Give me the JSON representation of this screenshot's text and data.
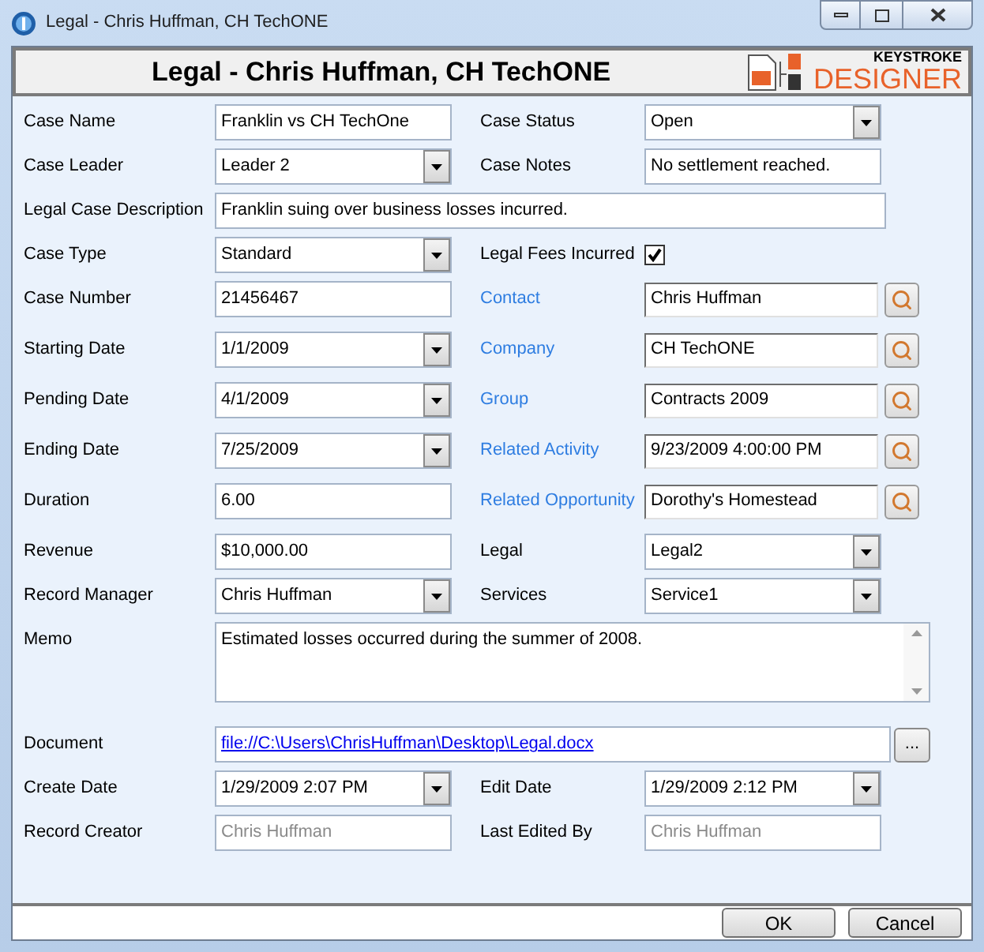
{
  "window": {
    "title": "Legal - Chris Huffman, CH TechONE"
  },
  "header": {
    "title": "Legal - Chris Huffman, CH TechONE",
    "logo_top": "KEYSTROKE",
    "logo_bottom": "DESIGNER"
  },
  "rows": [
    {
      "cells": [
        {
          "label": "Case Name",
          "link": false,
          "kind": "text",
          "value": "Franklin vs CH TechOne"
        },
        {
          "label": "Case Status",
          "link": false,
          "kind": "dropdown",
          "value": "Open"
        }
      ]
    },
    {
      "cells": [
        {
          "label": "Case Leader",
          "link": false,
          "kind": "dropdown",
          "value": "Leader 2"
        },
        {
          "label": "Case Notes",
          "link": false,
          "kind": "text",
          "value": "No settlement reached."
        }
      ]
    },
    {
      "cells": [
        {
          "label": "Legal Case Description",
          "link": false,
          "kind": "wide",
          "value": "Franklin suing over business losses incurred."
        }
      ]
    },
    {
      "cells": [
        {
          "label": "Case Type",
          "link": false,
          "kind": "dropdown",
          "value": "Standard"
        },
        {
          "label": "Legal Fees Incurred",
          "link": false,
          "kind": "checkbox",
          "checked": true
        }
      ]
    },
    {
      "cells": [
        {
          "label": "Case Number",
          "link": false,
          "kind": "text",
          "value": "21456467"
        },
        {
          "label": "Contact",
          "link": true,
          "kind": "lookup",
          "value": "Chris Huffman"
        }
      ]
    },
    {
      "cells": [
        {
          "label": "Starting Date",
          "link": false,
          "kind": "dropdown",
          "value": "1/1/2009"
        },
        {
          "label": "Company",
          "link": true,
          "kind": "lookup",
          "value": "CH TechONE"
        }
      ]
    },
    {
      "cells": [
        {
          "label": "Pending Date",
          "link": false,
          "kind": "dropdown",
          "value": "4/1/2009"
        },
        {
          "label": "Group",
          "link": true,
          "kind": "lookup",
          "value": "Contracts 2009"
        }
      ]
    },
    {
      "cells": [
        {
          "label": "Ending Date",
          "link": false,
          "kind": "dropdown",
          "value": "7/25/2009"
        },
        {
          "label": "Related Activity",
          "link": true,
          "kind": "lookup",
          "value": "9/23/2009 4:00:00 PM"
        }
      ]
    },
    {
      "cells": [
        {
          "label": "Duration",
          "link": false,
          "kind": "text",
          "value": "6.00"
        },
        {
          "label": "Related Opportunity",
          "link": true,
          "kind": "lookup",
          "value": "Dorothy's Homestead"
        }
      ]
    },
    {
      "cells": [
        {
          "label": "Revenue",
          "link": false,
          "kind": "text",
          "value": "$10,000.00"
        },
        {
          "label": "Legal",
          "link": false,
          "kind": "dropdown",
          "value": "Legal2"
        }
      ]
    },
    {
      "cells": [
        {
          "label": "Record Manager",
          "link": false,
          "kind": "dropdown",
          "value": "Chris Huffman"
        },
        {
          "label": "Services",
          "link": false,
          "kind": "dropdown",
          "value": "Service1"
        }
      ]
    },
    {
      "cells": [
        {
          "label": "Memo",
          "link": false,
          "kind": "memo",
          "value": "Estimated losses occurred during the summer of 2008."
        }
      ]
    },
    {
      "cells": [
        {
          "label": "Document",
          "link": false,
          "kind": "file",
          "value": "file://C:\\Users\\ChrisHuffman\\Desktop\\Legal.docx",
          "browse": "..."
        }
      ]
    },
    {
      "cells": [
        {
          "label": "Create Date",
          "link": false,
          "kind": "dropdown",
          "value": "1/29/2009 2:07 PM"
        },
        {
          "label": "Edit Date",
          "link": false,
          "kind": "dropdown",
          "value": "1/29/2009 2:12 PM"
        }
      ]
    },
    {
      "cells": [
        {
          "label": "Record Creator",
          "link": false,
          "kind": "readonly",
          "value": "Chris Huffman"
        },
        {
          "label": "Last Edited By",
          "link": false,
          "kind": "readonly",
          "value": "Chris Huffman"
        }
      ]
    }
  ],
  "buttons": [
    "OK",
    "Cancel"
  ]
}
